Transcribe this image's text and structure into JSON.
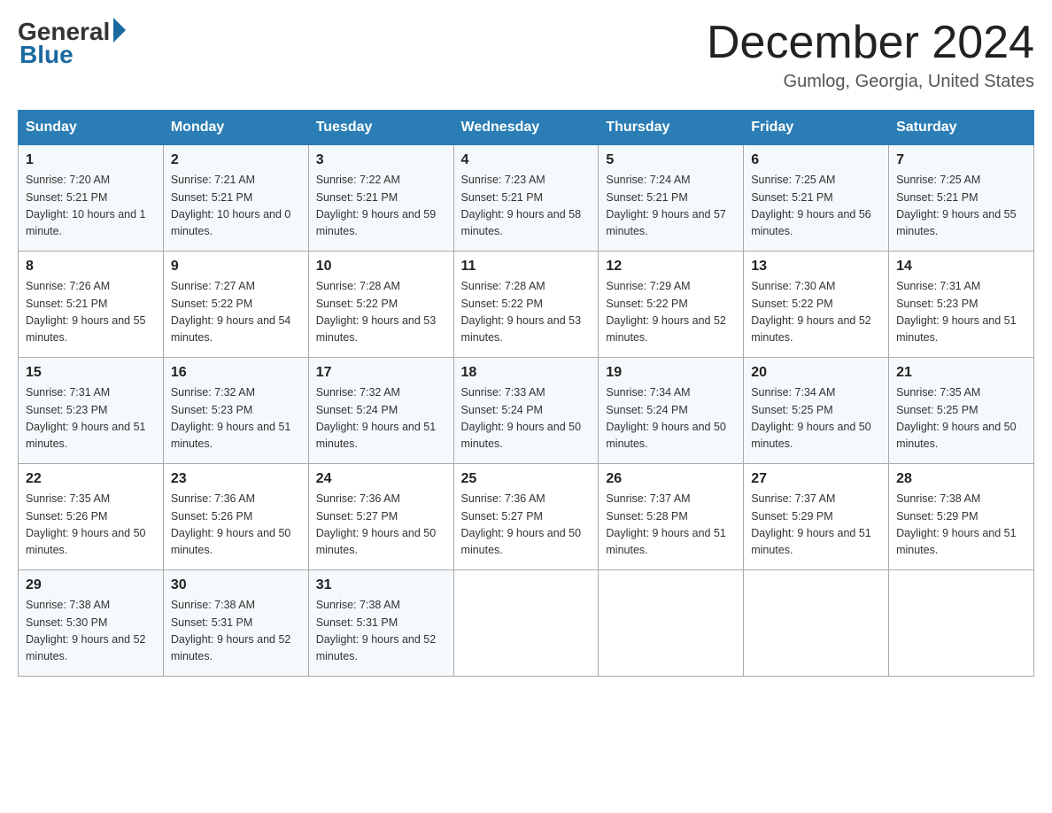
{
  "header": {
    "logo_general": "General",
    "logo_blue": "Blue",
    "month_title": "December 2024",
    "location": "Gumlog, Georgia, United States"
  },
  "weekdays": [
    "Sunday",
    "Monday",
    "Tuesday",
    "Wednesday",
    "Thursday",
    "Friday",
    "Saturday"
  ],
  "weeks": [
    [
      {
        "day": "1",
        "sunrise": "7:20 AM",
        "sunset": "5:21 PM",
        "daylight": "10 hours and 1 minute."
      },
      {
        "day": "2",
        "sunrise": "7:21 AM",
        "sunset": "5:21 PM",
        "daylight": "10 hours and 0 minutes."
      },
      {
        "day": "3",
        "sunrise": "7:22 AM",
        "sunset": "5:21 PM",
        "daylight": "9 hours and 59 minutes."
      },
      {
        "day": "4",
        "sunrise": "7:23 AM",
        "sunset": "5:21 PM",
        "daylight": "9 hours and 58 minutes."
      },
      {
        "day": "5",
        "sunrise": "7:24 AM",
        "sunset": "5:21 PM",
        "daylight": "9 hours and 57 minutes."
      },
      {
        "day": "6",
        "sunrise": "7:25 AM",
        "sunset": "5:21 PM",
        "daylight": "9 hours and 56 minutes."
      },
      {
        "day": "7",
        "sunrise": "7:25 AM",
        "sunset": "5:21 PM",
        "daylight": "9 hours and 55 minutes."
      }
    ],
    [
      {
        "day": "8",
        "sunrise": "7:26 AM",
        "sunset": "5:21 PM",
        "daylight": "9 hours and 55 minutes."
      },
      {
        "day": "9",
        "sunrise": "7:27 AM",
        "sunset": "5:22 PM",
        "daylight": "9 hours and 54 minutes."
      },
      {
        "day": "10",
        "sunrise": "7:28 AM",
        "sunset": "5:22 PM",
        "daylight": "9 hours and 53 minutes."
      },
      {
        "day": "11",
        "sunrise": "7:28 AM",
        "sunset": "5:22 PM",
        "daylight": "9 hours and 53 minutes."
      },
      {
        "day": "12",
        "sunrise": "7:29 AM",
        "sunset": "5:22 PM",
        "daylight": "9 hours and 52 minutes."
      },
      {
        "day": "13",
        "sunrise": "7:30 AM",
        "sunset": "5:22 PM",
        "daylight": "9 hours and 52 minutes."
      },
      {
        "day": "14",
        "sunrise": "7:31 AM",
        "sunset": "5:23 PM",
        "daylight": "9 hours and 51 minutes."
      }
    ],
    [
      {
        "day": "15",
        "sunrise": "7:31 AM",
        "sunset": "5:23 PM",
        "daylight": "9 hours and 51 minutes."
      },
      {
        "day": "16",
        "sunrise": "7:32 AM",
        "sunset": "5:23 PM",
        "daylight": "9 hours and 51 minutes."
      },
      {
        "day": "17",
        "sunrise": "7:32 AM",
        "sunset": "5:24 PM",
        "daylight": "9 hours and 51 minutes."
      },
      {
        "day": "18",
        "sunrise": "7:33 AM",
        "sunset": "5:24 PM",
        "daylight": "9 hours and 50 minutes."
      },
      {
        "day": "19",
        "sunrise": "7:34 AM",
        "sunset": "5:24 PM",
        "daylight": "9 hours and 50 minutes."
      },
      {
        "day": "20",
        "sunrise": "7:34 AM",
        "sunset": "5:25 PM",
        "daylight": "9 hours and 50 minutes."
      },
      {
        "day": "21",
        "sunrise": "7:35 AM",
        "sunset": "5:25 PM",
        "daylight": "9 hours and 50 minutes."
      }
    ],
    [
      {
        "day": "22",
        "sunrise": "7:35 AM",
        "sunset": "5:26 PM",
        "daylight": "9 hours and 50 minutes."
      },
      {
        "day": "23",
        "sunrise": "7:36 AM",
        "sunset": "5:26 PM",
        "daylight": "9 hours and 50 minutes."
      },
      {
        "day": "24",
        "sunrise": "7:36 AM",
        "sunset": "5:27 PM",
        "daylight": "9 hours and 50 minutes."
      },
      {
        "day": "25",
        "sunrise": "7:36 AM",
        "sunset": "5:27 PM",
        "daylight": "9 hours and 50 minutes."
      },
      {
        "day": "26",
        "sunrise": "7:37 AM",
        "sunset": "5:28 PM",
        "daylight": "9 hours and 51 minutes."
      },
      {
        "day": "27",
        "sunrise": "7:37 AM",
        "sunset": "5:29 PM",
        "daylight": "9 hours and 51 minutes."
      },
      {
        "day": "28",
        "sunrise": "7:38 AM",
        "sunset": "5:29 PM",
        "daylight": "9 hours and 51 minutes."
      }
    ],
    [
      {
        "day": "29",
        "sunrise": "7:38 AM",
        "sunset": "5:30 PM",
        "daylight": "9 hours and 52 minutes."
      },
      {
        "day": "30",
        "sunrise": "7:38 AM",
        "sunset": "5:31 PM",
        "daylight": "9 hours and 52 minutes."
      },
      {
        "day": "31",
        "sunrise": "7:38 AM",
        "sunset": "5:31 PM",
        "daylight": "9 hours and 52 minutes."
      },
      null,
      null,
      null,
      null
    ]
  ]
}
